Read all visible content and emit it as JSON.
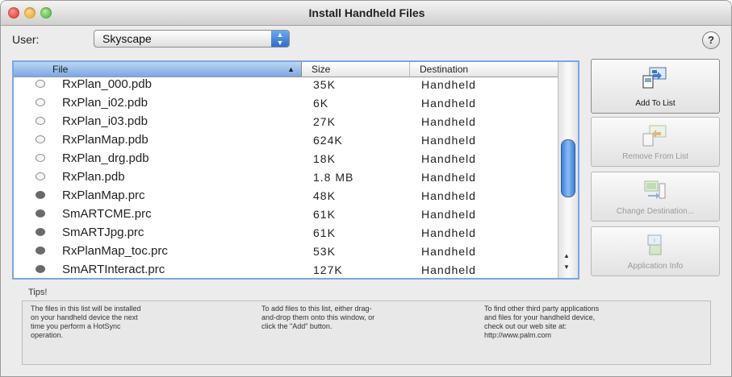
{
  "window": {
    "title": "Install Handheld Files"
  },
  "user": {
    "label": "User:",
    "selected": "Skyscape"
  },
  "help": {
    "label": "?"
  },
  "table": {
    "columns": {
      "file": "File",
      "size": "Size",
      "destination": "Destination"
    },
    "rows": [
      {
        "type": "pdb",
        "name": "RxPlan_000.pdb",
        "size": "35K",
        "destination": "Handheld"
      },
      {
        "type": "pdb",
        "name": "RxPlan_i02.pdb",
        "size": "6K",
        "destination": "Handheld"
      },
      {
        "type": "pdb",
        "name": "RxPlan_i03.pdb",
        "size": "27K",
        "destination": "Handheld"
      },
      {
        "type": "pdb",
        "name": "RxPlanMap.pdb",
        "size": "624K",
        "destination": "Handheld"
      },
      {
        "type": "pdb",
        "name": "RxPlan_drg.pdb",
        "size": "18K",
        "destination": "Handheld"
      },
      {
        "type": "pdb",
        "name": "RxPlan.pdb",
        "size": "1.8 MB",
        "destination": "Handheld"
      },
      {
        "type": "prc",
        "name": "RxPlanMap.prc",
        "size": "48K",
        "destination": "Handheld"
      },
      {
        "type": "prc",
        "name": "SmARTCME.prc",
        "size": "61K",
        "destination": "Handheld"
      },
      {
        "type": "prc",
        "name": "SmARTJpg.prc",
        "size": "61K",
        "destination": "Handheld"
      },
      {
        "type": "prc",
        "name": "RxPlanMap_toc.prc",
        "size": "53K",
        "destination": "Handheld"
      },
      {
        "type": "prc",
        "name": "SmARTInteract.prc",
        "size": "127K",
        "destination": "Handheld"
      }
    ]
  },
  "buttons": {
    "add": "Add To List",
    "remove": "Remove From List",
    "change": "Change Destination...",
    "appinfo": "Application Info"
  },
  "tips": {
    "title": "Tips!",
    "col1": "The files in this list will be installed\non your handheld device the next\ntime you perform a HotSync\noperation.",
    "col2": "To add files to this list, either drag-\nand-drop them onto this window, or\nclick the \"Add\" button.",
    "col3": "To find other third party applications\nand files for your handheld device,\ncheck out our web site at:\nhttp://www.palm.com"
  },
  "colors": {
    "accent": "#3a7fdc",
    "selection_header": "#7aa8e2"
  }
}
